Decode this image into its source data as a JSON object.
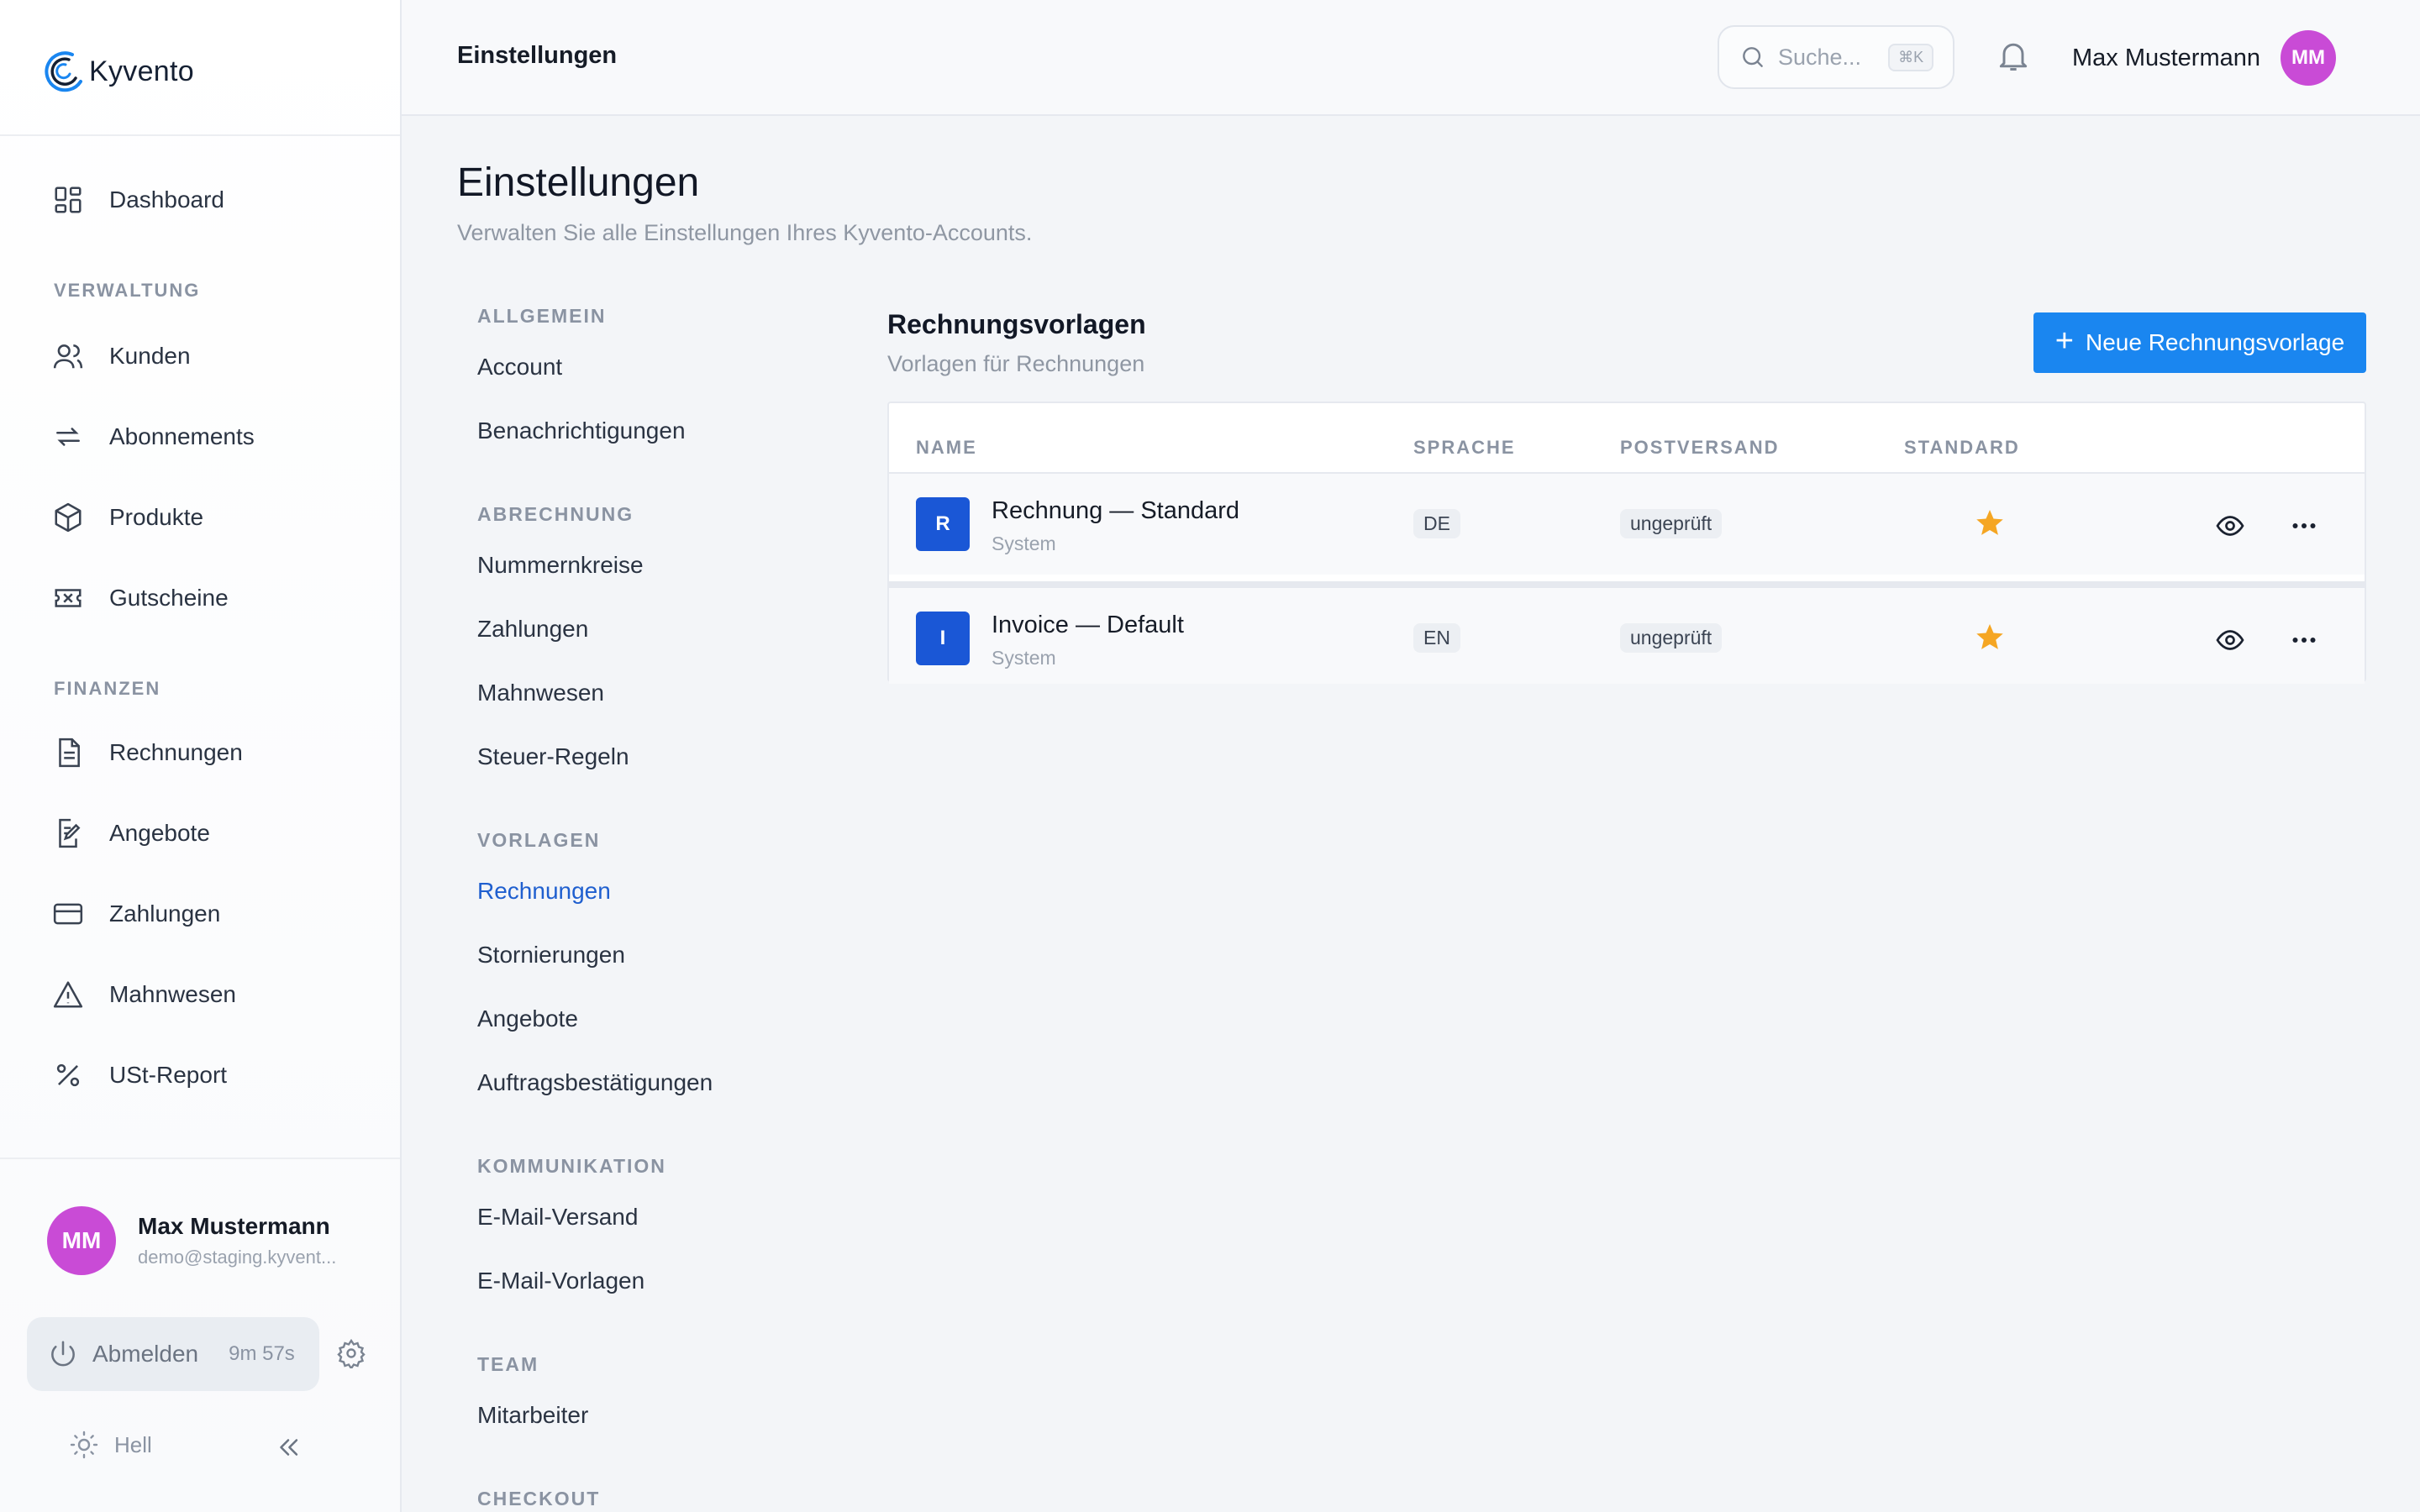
{
  "app": {
    "logo_text": "Kyvento"
  },
  "sidebar": {
    "dashboard": "Dashboard",
    "section_verwaltung": "VERWALTUNG",
    "kunden": "Kunden",
    "abonnements": "Abonnements",
    "produkte": "Produkte",
    "gutscheine": "Gutscheine",
    "section_finanzen": "FINANZEN",
    "rechnungen": "Rechnungen",
    "angebote": "Angebote",
    "zahlungen": "Zahlungen",
    "mahnwesen": "Mahnwesen",
    "ust_report": "USt-Report",
    "user": {
      "initials": "MM",
      "name": "Max Mustermann",
      "email": "demo@staging.kyvent..."
    },
    "logout_label": "Abmelden",
    "logout_timer": "9m 57s",
    "theme_label": "Hell"
  },
  "topbar": {
    "title": "Einstellungen",
    "search_placeholder": "Suche...",
    "search_shortcut": "⌘K",
    "user_name": "Max Mustermann",
    "user_initials": "MM"
  },
  "page": {
    "title": "Einstellungen",
    "subtitle": "Verwalten Sie alle Einstellungen Ihres Kyvento-Accounts."
  },
  "settings_nav": {
    "allgemein": "ALLGEMEIN",
    "account": "Account",
    "benachrichtigungen": "Benachrichtigungen",
    "abrechnung": "ABRECHNUNG",
    "nummernkreise": "Nummernkreise",
    "zahlungen": "Zahlungen",
    "mahnwesen": "Mahnwesen",
    "steuer_regeln": "Steuer-Regeln",
    "vorlagen": "VORLAGEN",
    "rechnungen": "Rechnungen",
    "stornierungen": "Stornierungen",
    "angebote": "Angebote",
    "auftragsbestaetigungen": "Auftragsbestätigungen",
    "kommunikation": "KOMMUNIKATION",
    "email_versand": "E-Mail-Versand",
    "email_vorlagen": "E-Mail-Vorlagen",
    "team": "TEAM",
    "mitarbeiter": "Mitarbeiter",
    "checkout": "CHECKOUT"
  },
  "panel": {
    "title": "Rechnungsvorlagen",
    "subtitle": "Vorlagen für Rechnungen",
    "new_button": "Neue Rechnungsvorlage",
    "columns": {
      "name": "NAME",
      "sprache": "SPRACHE",
      "postversand": "POSTVERSAND",
      "standard": "STANDARD"
    },
    "rows": [
      {
        "badge": "R",
        "name": "Rechnung — Standard",
        "source": "System",
        "language": "DE",
        "postversand": "ungeprüft"
      },
      {
        "badge": "I",
        "name": "Invoice — Default",
        "source": "System",
        "language": "EN",
        "postversand": "ungeprüft"
      }
    ]
  },
  "colors": {
    "accent": "#1a86f0",
    "avatar": "#c94bd6",
    "badge": "#1a57d6",
    "star": "#f5a623",
    "active_link": "#1f5fcf"
  }
}
